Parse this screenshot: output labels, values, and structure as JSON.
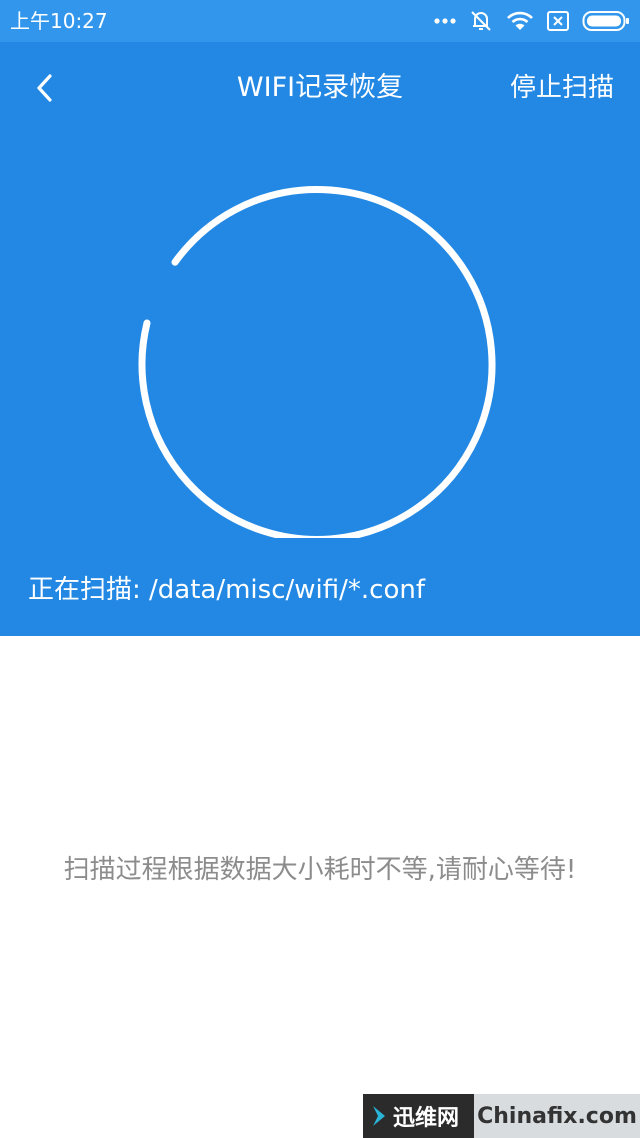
{
  "status_bar": {
    "time": "上午10:27",
    "icons": [
      "more-dots-icon",
      "silent-bell-icon",
      "wifi-icon",
      "sim-blocked-icon",
      "battery-icon"
    ]
  },
  "header": {
    "title": "WIFI记录恢复",
    "stop_label": "停止扫描",
    "back_icon": "chevron-left-icon",
    "scan_path": "正在扫描: /data/misc/wifi/*.conf"
  },
  "content": {
    "message": "扫描过程根据数据大小耗时不等,请耐心等待!"
  },
  "watermark": {
    "left_text": "迅维网",
    "right_text": "Chinafix.com"
  },
  "colors": {
    "status_bar": "#3297ec",
    "header": "#2288e4",
    "message_text": "#8c8c8c"
  }
}
